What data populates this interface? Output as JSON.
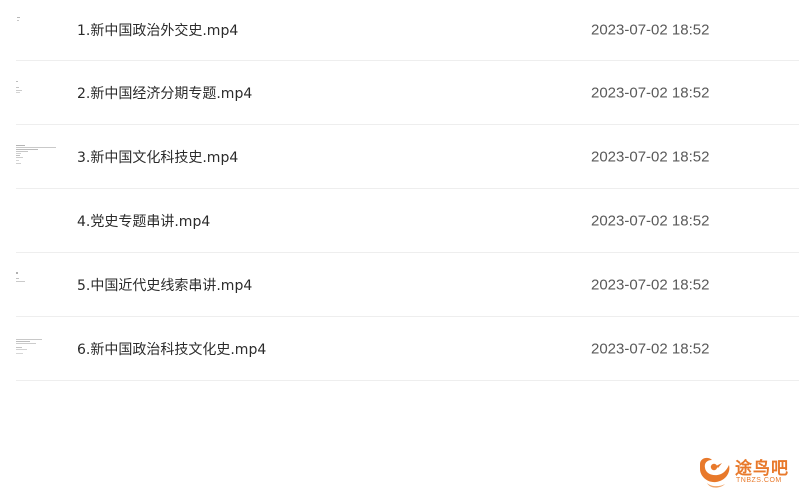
{
  "files": [
    {
      "name": "1.新中国政治外交史.mp4",
      "date": "2023-07-02 18:52"
    },
    {
      "name": "2.新中国经济分期专题.mp4",
      "date": "2023-07-02 18:52"
    },
    {
      "name": "3.新中国文化科技史.mp4",
      "date": "2023-07-02 18:52"
    },
    {
      "name": "4.党史专题串讲.mp4",
      "date": "2023-07-02 18:52"
    },
    {
      "name": "5.中国近代史线索串讲.mp4",
      "date": "2023-07-02 18:52"
    },
    {
      "name": "6.新中国政治科技文化史.mp4",
      "date": "2023-07-02 18:52"
    }
  ],
  "watermark": {
    "text": "途鸟吧",
    "subtext": "TNBZS.COM",
    "color": "#e8792b"
  }
}
